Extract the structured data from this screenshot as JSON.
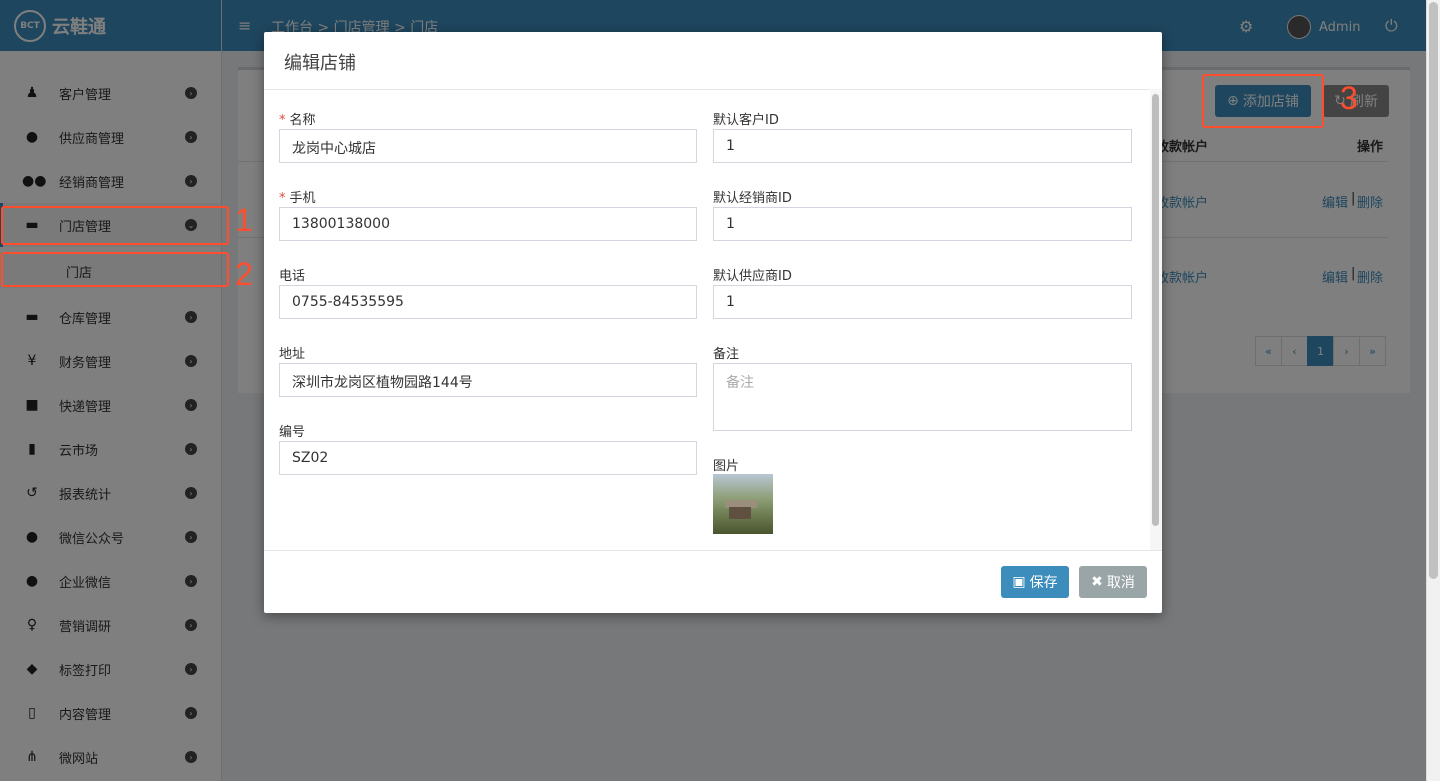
{
  "app": {
    "name": "云鞋通",
    "logo_text": "BCT"
  },
  "topbar": {
    "breadcrumb": "工作台 > 门店管理 > 门店",
    "user": "Admin"
  },
  "sidebar": {
    "items": [
      {
        "label": "客户管理",
        "icon": "user-standing-icon"
      },
      {
        "label": "供应商管理",
        "icon": "user-icon"
      },
      {
        "label": "经销商管理",
        "icon": "users-icon"
      },
      {
        "label": "门店管理",
        "icon": "archive-icon"
      },
      {
        "label": "仓库管理",
        "icon": "archive-icon"
      },
      {
        "label": "财务管理",
        "icon": "yen-icon"
      },
      {
        "label": "快递管理",
        "icon": "truck-icon"
      },
      {
        "label": "云市场",
        "icon": "building-icon"
      },
      {
        "label": "报表统计",
        "icon": "history-icon"
      },
      {
        "label": "微信公众号",
        "icon": "wechat-icon"
      },
      {
        "label": "企业微信",
        "icon": "wechat-icon"
      },
      {
        "label": "营销调研",
        "icon": "lightbulb-icon"
      },
      {
        "label": "标签打印",
        "icon": "tags-icon"
      },
      {
        "label": "内容管理",
        "icon": "file-icon"
      },
      {
        "label": "微网站",
        "icon": "sitemap-icon"
      }
    ],
    "sub_item": "门店"
  },
  "main": {
    "add_button": "添加店铺",
    "refresh_button": "刷新",
    "col_account": "收款帐户",
    "col_action": "操作",
    "rows": [
      {
        "account": "收款帐户",
        "edit": "编辑",
        "sep": "|",
        "delete": "删除"
      },
      {
        "account": "收款帐户",
        "edit": "编辑",
        "sep": "|",
        "delete": "删除"
      }
    ],
    "pager": [
      "«",
      "‹",
      "1",
      "›",
      "»"
    ]
  },
  "modal": {
    "title": "编辑店铺",
    "required_mark": "*",
    "name_label": "名称",
    "name_value": "龙岗中心城店",
    "phone_label": "手机",
    "phone_value": "13800138000",
    "tel_label": "电话",
    "tel_value": "0755-84535595",
    "address_label": "地址",
    "address_value": "深圳市龙岗区植物园路144号",
    "code_label": "编号",
    "code_value": "SZ02",
    "customer_label": "默认客户ID",
    "customer_value": "1",
    "dealer_label": "默认经销商ID",
    "dealer_value": "1",
    "supplier_label": "默认供应商ID",
    "supplier_value": "1",
    "remark_label": "备注",
    "remark_placeholder": "备注",
    "image_label": "图片",
    "save_button": "保存",
    "cancel_button": "取消"
  },
  "annotations": [
    "1",
    "2",
    "3"
  ],
  "colors": {
    "primary": "#3c8dbc",
    "annotation": "#ff4d2e"
  }
}
